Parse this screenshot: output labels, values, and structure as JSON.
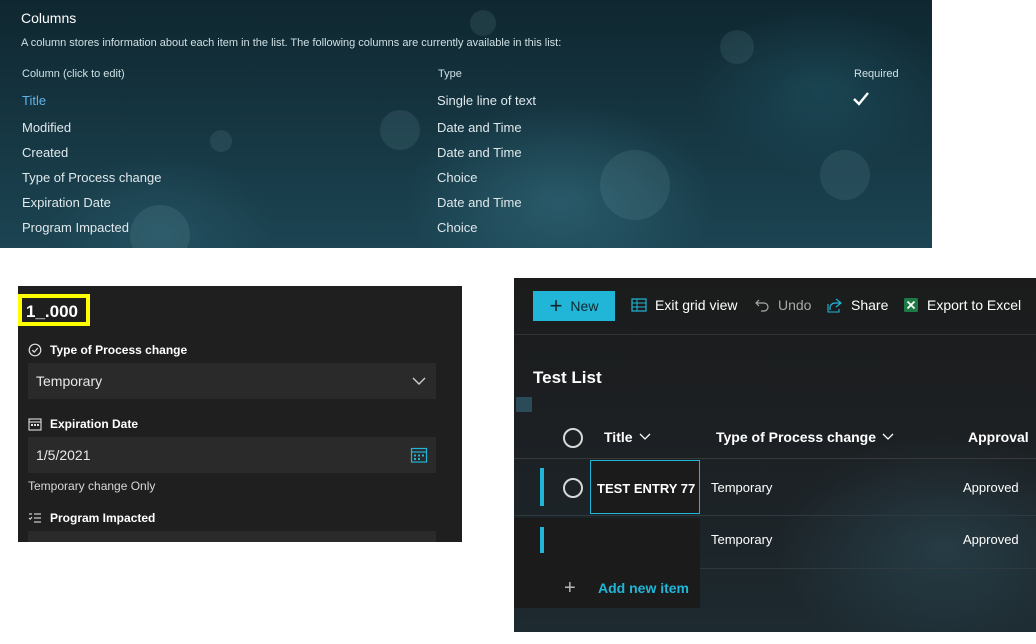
{
  "columns_panel": {
    "title": "Columns",
    "description": "A column stores information about each item in the list. The following columns are currently available in this list:",
    "headers": {
      "column": "Column (click to edit)",
      "type": "Type",
      "required": "Required"
    },
    "rows": [
      {
        "name": "Title",
        "type": "Single line of text",
        "required": true
      },
      {
        "name": "Modified",
        "type": "Date and Time",
        "required": false
      },
      {
        "name": "Created",
        "type": "Date and Time",
        "required": false
      },
      {
        "name": "Type of Process change",
        "type": "Choice",
        "required": false
      },
      {
        "name": "Expiration Date",
        "type": "Date and Time",
        "required": false
      },
      {
        "name": "Program Impacted",
        "type": "Choice",
        "required": false
      }
    ],
    "link_color": "#5fb3e8"
  },
  "form_panel": {
    "item_id": "1_.000",
    "highlight_color": "#ffff00",
    "process_change": {
      "label": "Type of Process change",
      "value": "Temporary",
      "icon": "check-circle-icon"
    },
    "expiration": {
      "label": "Expiration Date",
      "value": "1/5/2021",
      "icon": "calendar-icon",
      "hint": "Temporary change Only"
    },
    "program": {
      "label": "Program Impacted",
      "icon": "list-icon"
    }
  },
  "list_panel": {
    "toolbar": {
      "new_label": "New",
      "exit_grid_label": "Exit grid view",
      "undo_label": "Undo",
      "share_label": "Share",
      "export_label": "Export to Excel"
    },
    "list_title": "Test List",
    "columns": {
      "title": "Title",
      "process_change": "Type of Process change",
      "approval": "Approval"
    },
    "rows": [
      {
        "title": "TEST ENTRY 77",
        "process_change": "Temporary",
        "approval": "Approved"
      },
      {
        "title": "",
        "process_change": "Temporary",
        "approval": "Approved"
      }
    ],
    "add_new_label": "Add new item",
    "accent_color": "#21b6d7"
  }
}
